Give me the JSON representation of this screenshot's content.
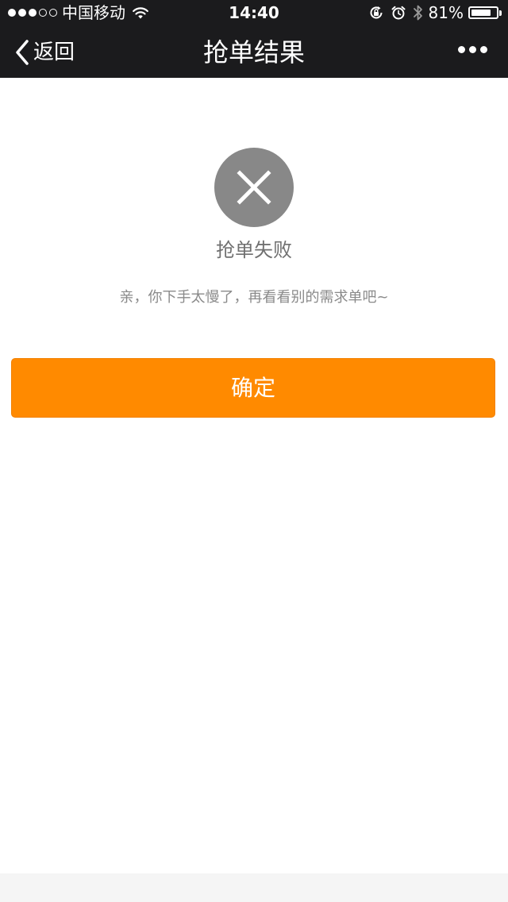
{
  "status_bar": {
    "carrier": "中国移动",
    "time": "14:40",
    "battery_percent": "81%",
    "battery_level": 0.81,
    "signal_bars_filled": 3,
    "signal_bars_total": 5
  },
  "nav": {
    "back_label": "返回",
    "title": "抢单结果"
  },
  "result": {
    "icon": "close-icon",
    "title": "抢单失败",
    "message": "亲，你下手太慢了，再看看别的需求单吧~"
  },
  "actions": {
    "confirm_label": "确定"
  },
  "colors": {
    "nav_background": "#1b1b1d",
    "accent": "#ff8a00",
    "icon_circle": "#888888"
  }
}
